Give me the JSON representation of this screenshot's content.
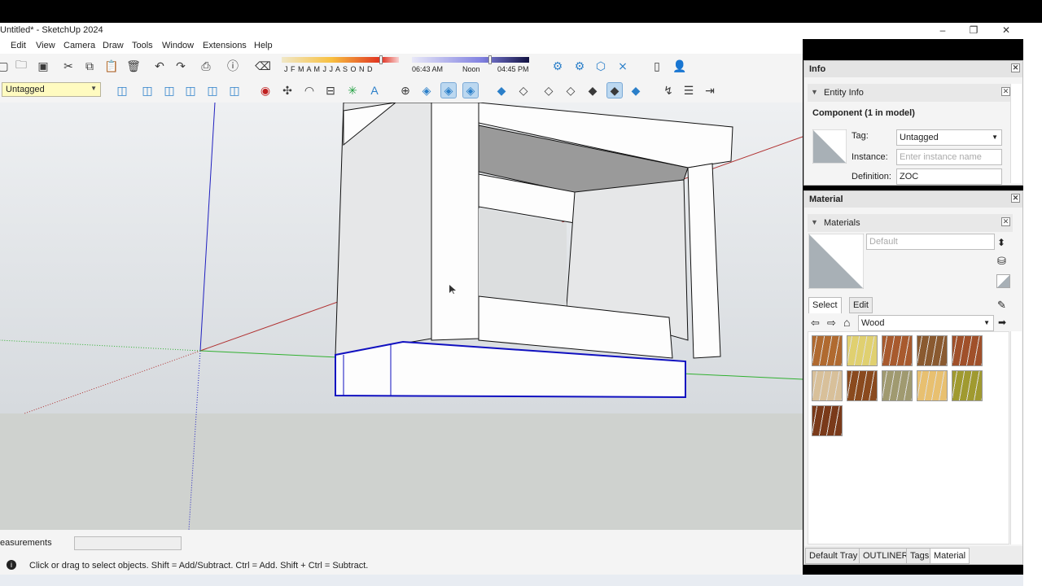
{
  "window": {
    "title": "Untitled* - SketchUp 2024",
    "minimize": "–",
    "maximize": "❐",
    "close": "✕"
  },
  "menu": [
    "Edit",
    "View",
    "Camera",
    "Draw",
    "Tools",
    "Window",
    "Extensions",
    "Help"
  ],
  "shadows": {
    "months": "J F M A M J J A S O N D",
    "time_start": "06:43 AM",
    "time_mid": "Noon",
    "time_end": "04:45 PM"
  },
  "tag_select": {
    "value": "Untagged"
  },
  "measurements": {
    "label": "easurements",
    "value": ""
  },
  "status": {
    "text": "Click or drag to select objects. Shift = Add/Subtract. Ctrl = Add. Shift + Ctrl = Subtract."
  },
  "info_panel": {
    "title": "Info",
    "section": "Entity Info",
    "heading": "Component (1 in model)",
    "tag_label": "Tag:",
    "tag_value": "Untagged",
    "instance_label": "Instance:",
    "instance_placeholder": "Enter instance name",
    "definition_label": "Definition:",
    "definition_value": "ZOC"
  },
  "material_panel": {
    "title": "Material",
    "section": "Materials",
    "name_placeholder": "Default",
    "tabs": [
      "Select",
      "Edit"
    ],
    "library": "Wood",
    "swatches": [
      "#b06a30",
      "#e0d070",
      "#a85a2e",
      "#8a5a30",
      "#a0502a",
      "#d8c09a",
      "#8a4a1e",
      "#a09a70",
      "#e8c070",
      "#a09a30",
      "#7a3a1a"
    ]
  },
  "tray_tabs": [
    "Default Tray",
    "OUTLINER",
    "Tags",
    "Material"
  ],
  "colors": {
    "accent": "#2b7fc9",
    "tag_bg": "#fffbc0",
    "red_axis": "#b03030",
    "green_axis": "#30b030",
    "blue_axis": "#2020c0"
  }
}
